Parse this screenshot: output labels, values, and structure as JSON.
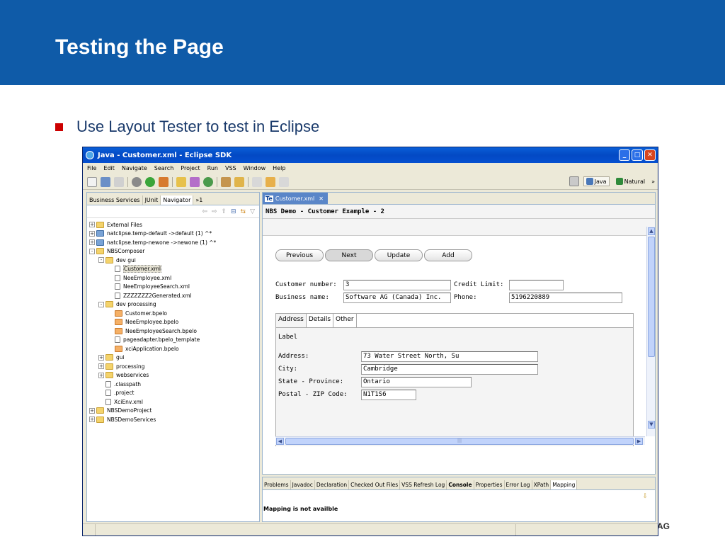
{
  "slide": {
    "title": "Testing the Page",
    "bullet": "Use Layout Tester to test in Eclipse",
    "footer_fragment": "AG",
    "colors": {
      "header_bg": "#0f5ba8",
      "bullet": "#cc0000",
      "text": "#1a3a6b"
    }
  },
  "window": {
    "title": "Java - Customer.xml - Eclipse SDK",
    "menu": [
      "File",
      "Edit",
      "Navigate",
      "Search",
      "Project",
      "Run",
      "VSS",
      "Window",
      "Help"
    ],
    "perspectives": [
      "Java",
      "Natural"
    ],
    "perspective_more": "»"
  },
  "navigator": {
    "tabs": [
      "Business Services",
      "JUnit",
      "Navigator",
      "»1"
    ],
    "tree": [
      {
        "label": "External Files",
        "level": 0,
        "expander": "+",
        "icon": "folder"
      },
      {
        "label": "natclipse.temp-default ->default (1) ^*",
        "level": 0,
        "expander": "+",
        "icon": "proj"
      },
      {
        "label": "natclipse.temp-newone ->newone (1) ^*",
        "level": 0,
        "expander": "+",
        "icon": "proj"
      },
      {
        "label": "NBSComposer",
        "level": 0,
        "expander": "-",
        "icon": "folder"
      },
      {
        "label": "dev gui",
        "level": 1,
        "expander": "-",
        "icon": "folder"
      },
      {
        "label": "Customer.xml",
        "level": 2,
        "expander": "",
        "icon": "file",
        "selected": true
      },
      {
        "label": "NeeEmployee.xml",
        "level": 2,
        "expander": "",
        "icon": "file"
      },
      {
        "label": "NeeEmployeeSearch.xml",
        "level": 2,
        "expander": "",
        "icon": "file"
      },
      {
        "label": "ZZZZZZZ2Generated.xml",
        "level": 2,
        "expander": "",
        "icon": "file"
      },
      {
        "label": "dev processing",
        "level": 1,
        "expander": "-",
        "icon": "folder"
      },
      {
        "label": "Customer.bpelo",
        "level": 2,
        "expander": "",
        "icon": "bpelo"
      },
      {
        "label": "NeeEmployee.bpelo",
        "level": 2,
        "expander": "",
        "icon": "bpelo"
      },
      {
        "label": "NeeEmployeeSearch.bpelo",
        "level": 2,
        "expander": "",
        "icon": "bpelo"
      },
      {
        "label": "pageadapter.bpelo_template",
        "level": 2,
        "expander": "",
        "icon": "file"
      },
      {
        "label": "xciApplication.bpelo",
        "level": 2,
        "expander": "",
        "icon": "bpelo"
      },
      {
        "label": "gui",
        "level": 1,
        "expander": "+",
        "icon": "folder"
      },
      {
        "label": "processing",
        "level": 1,
        "expander": "+",
        "icon": "folder"
      },
      {
        "label": "webservices",
        "level": 1,
        "expander": "+",
        "icon": "folder"
      },
      {
        "label": ".classpath",
        "level": 1,
        "expander": "",
        "icon": "file"
      },
      {
        "label": ".project",
        "level": 1,
        "expander": "",
        "icon": "file"
      },
      {
        "label": "XciEnv.xml",
        "level": 1,
        "expander": "",
        "icon": "file"
      },
      {
        "label": "NBSDemoProject",
        "level": 0,
        "expander": "+",
        "icon": "folder"
      },
      {
        "label": "NBSDemoServices",
        "level": 0,
        "expander": "+",
        "icon": "folder"
      }
    ]
  },
  "editor": {
    "tab_badge": "Te",
    "tab_label": "Customer.xml",
    "tab_close": "✕",
    "form_title": "NBS Demo - Customer Example - 2",
    "buttons": [
      "Previous",
      "Next",
      "Update",
      "Add"
    ],
    "fields": {
      "customer_number_label": "Customer number:",
      "customer_number_value": "3",
      "credit_limit_label": "Credit Limit:",
      "credit_limit_value": "",
      "business_name_label": "Business name:",
      "business_name_value": "Software AG (Canada) Inc.",
      "phone_label": "Phone:",
      "phone_value": "5196220889"
    },
    "subtabs": [
      "Address",
      "Details",
      "Other"
    ],
    "address": {
      "section_label": "Label",
      "address_label": "Address:",
      "address_value": "73 Water Street North, Su",
      "city_label": "City:",
      "city_value": "Cambridge",
      "state_label": "State - Province:",
      "state_value": "Ontario",
      "postal_label": "Postal - ZIP Code:",
      "postal_value": "N1T1S6"
    },
    "scroll_grip": "|||"
  },
  "bottom": {
    "tabs": [
      "Problems",
      "Javadoc",
      "Declaration",
      "Checked Out Files",
      "VSS Refresh Log",
      "Console",
      "Properties",
      "Error Log",
      "XPath",
      "Mapping"
    ],
    "active_tab": "Mapping",
    "message": "Mapping is not availble"
  }
}
